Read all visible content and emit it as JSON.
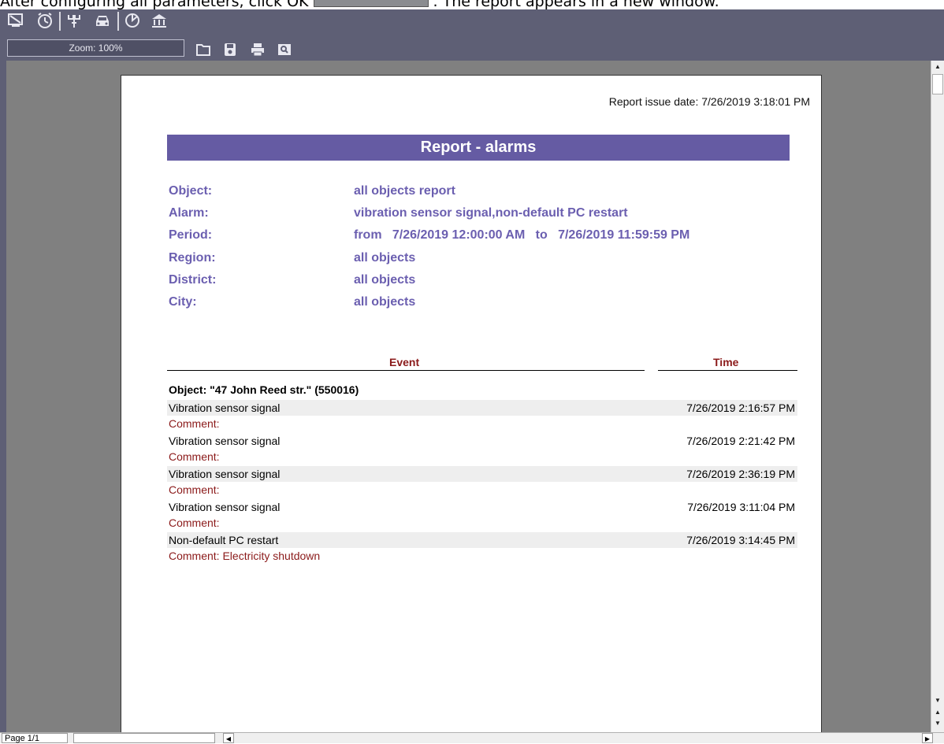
{
  "caption": {
    "text_before": "After configuring all parameters, click OK",
    "text_after": ". The report appears in a new window."
  },
  "toolbar": {
    "zoom_label": "Zoom: 100%",
    "icons": [
      "monitor-icon",
      "alarm-clock-icon",
      "wire-connector-icon",
      "car-icon",
      "pie-chart-icon",
      "building-icon"
    ],
    "file_icons": [
      "open-folder-icon",
      "save-icon",
      "print-icon",
      "preview-icon"
    ]
  },
  "report": {
    "issue_date": "Report issue date: 7/26/2019 3:18:01 PM",
    "title": "Report - alarms",
    "params": [
      {
        "label": "Object:",
        "value": "all objects report"
      },
      {
        "label": "Alarm:",
        "value": "vibration sensor signal,non-default PC restart"
      },
      {
        "label": "Period:",
        "value": "from   7/26/2019 12:00:00 AM   to   7/26/2019 11:59:59 PM"
      },
      {
        "label": "Region:",
        "value": "all objects"
      },
      {
        "label": "District:",
        "value": "all objects"
      },
      {
        "label": "City:",
        "value": "all objects"
      }
    ],
    "col_event": "Event",
    "col_time": "Time",
    "object_line": "Object: \"47 John Reed str.\" (550016)",
    "events": [
      {
        "event": "Vibration sensor signal",
        "time": "7/26/2019 2:16:57 PM",
        "comment": "Comment:"
      },
      {
        "event": "Vibration sensor signal",
        "time": "7/26/2019 2:21:42 PM",
        "comment": "Comment:"
      },
      {
        "event": "Vibration sensor signal",
        "time": "7/26/2019 2:36:19 PM",
        "comment": "Comment:"
      },
      {
        "event": "Vibration sensor signal",
        "time": "7/26/2019 3:11:04 PM",
        "comment": "Comment:"
      },
      {
        "event": "Non-default PC restart",
        "time": "7/26/2019 3:14:45 PM",
        "comment": "Comment: Electricity shutdown"
      }
    ]
  },
  "status": {
    "page_info": "Page 1/1"
  },
  "colors": {
    "toolbar_bg": "#5e5f75",
    "banner_bg": "#655ba3",
    "param_text": "#6b5fb0",
    "accent_red": "#8b1a1a"
  }
}
